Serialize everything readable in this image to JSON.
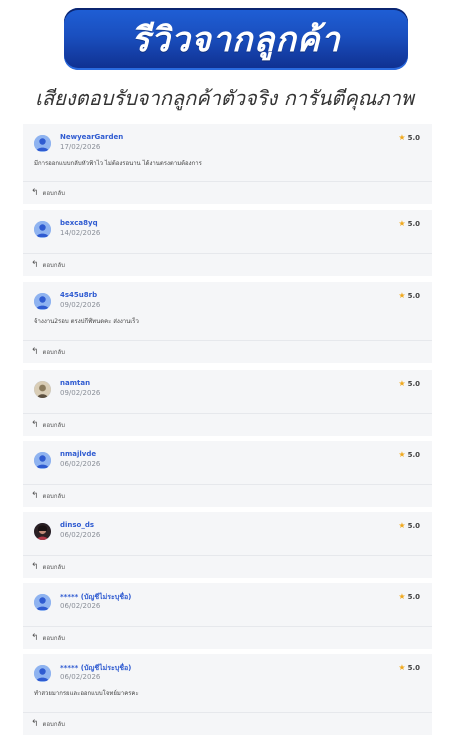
{
  "header": {
    "title": "รีวิวจากลูกค้า",
    "subtitle": "เสียงตอบรับจากลูกค้าตัวจริง การันตีคุณภาพ"
  },
  "reply_label": "ตอบกลับ",
  "reviews": [
    {
      "name": "NewyearGarden",
      "date": "17/02/2026",
      "rating": "5.0",
      "comment": "มีการออกแบบกลับหัวฟ้าไว ไม่ต้องรอนาน ได้งานตรงตามต้องการ",
      "avatar": "default"
    },
    {
      "name": "bexca8yq",
      "date": "14/02/2026",
      "rating": "5.0",
      "comment": "",
      "avatar": "default"
    },
    {
      "name": "4s45u8rb",
      "date": "09/02/2026",
      "rating": "5.0",
      "comment": "จ้างงาน2รอบ ตรงปกีฬ์ทนดคะ ส่งงานเร็ว",
      "avatar": "default"
    },
    {
      "name": "namtan",
      "date": "09/02/2026",
      "rating": "5.0",
      "comment": "",
      "avatar": "photo-beige"
    },
    {
      "name": "nmajlvde",
      "date": "06/02/2026",
      "rating": "5.0",
      "comment": "",
      "avatar": "default"
    },
    {
      "name": "dinso_ds",
      "date": "06/02/2026",
      "rating": "5.0",
      "comment": "",
      "avatar": "photo-dark"
    },
    {
      "name": "***** (บัญชีไม่ระบุชื่อ)",
      "date": "06/02/2026",
      "rating": "5.0",
      "comment": "",
      "avatar": "default"
    },
    {
      "name": "***** (บัญชีไม่ระบุชื่อ)",
      "date": "06/02/2026",
      "rating": "5.0",
      "comment": "ทำสวยมากรยและออกแบบโจทย์มาครคะ",
      "avatar": "default"
    }
  ],
  "colors": {
    "accent": "#2f5bd1",
    "star": "#f0a81c",
    "banner": "#1a4fbf"
  }
}
